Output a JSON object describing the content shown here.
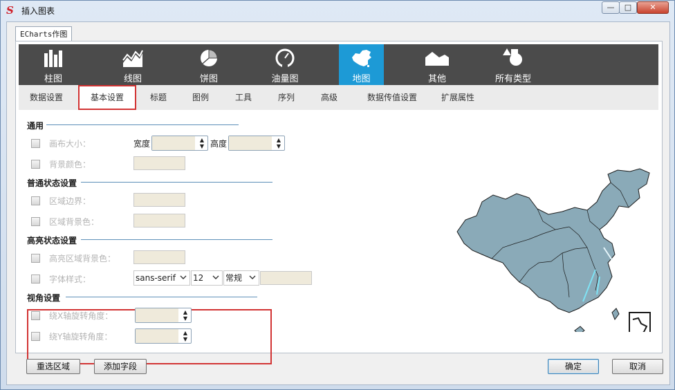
{
  "window": {
    "title": "插入图表",
    "app_icon": "S"
  },
  "tab": {
    "label": "ECharts作图"
  },
  "chart_types": [
    {
      "label": "柱图",
      "icon": "bar-chart-icon",
      "selected": false
    },
    {
      "label": "线图",
      "icon": "line-chart-icon",
      "selected": false
    },
    {
      "label": "饼图",
      "icon": "pie-chart-icon",
      "selected": false
    },
    {
      "label": "油量图",
      "icon": "gauge-icon",
      "selected": false
    },
    {
      "label": "地图",
      "icon": "china-map-icon",
      "selected": true
    },
    {
      "label": "其他",
      "icon": "area-chart-icon",
      "selected": false
    },
    {
      "label": "所有类型",
      "icon": "shapes-icon",
      "selected": false
    }
  ],
  "subtabs": [
    "数据设置",
    "基本设置",
    "标题",
    "图例",
    "工具",
    "序列",
    "高级",
    "数据传值设置",
    "扩展属性"
  ],
  "active_subtab": "基本设置",
  "sections": {
    "general": {
      "title": "通用",
      "canvas_size_label": "画布大小：",
      "width_label": "宽度",
      "height_label": "高度",
      "bg_color_label": "背景颜色："
    },
    "normal": {
      "title": "普通状态设置",
      "border_label": "区域边界：",
      "bg_label": "区域背景色："
    },
    "highlight": {
      "title": "高亮状态设置",
      "bg_label": "高亮区域背景色：",
      "font_label": "字体样式：",
      "font_family": "sans-serif",
      "font_size": "12",
      "font_weight": "常规"
    },
    "view": {
      "title": "视角设置",
      "x_rot_label": "绕X轴旋转角度：",
      "y_rot_label": "绕Y轴旋转角度："
    }
  },
  "buttons": {
    "reselect": "重选区域",
    "add_field": "添加字段",
    "ok": "确定",
    "cancel": "取消"
  },
  "colors": {
    "toolbar_bg": "#4b4b4b",
    "selected_type": "#1d9ad6",
    "highlight_border": "#d23333",
    "map_fill": "#8aaab8"
  }
}
